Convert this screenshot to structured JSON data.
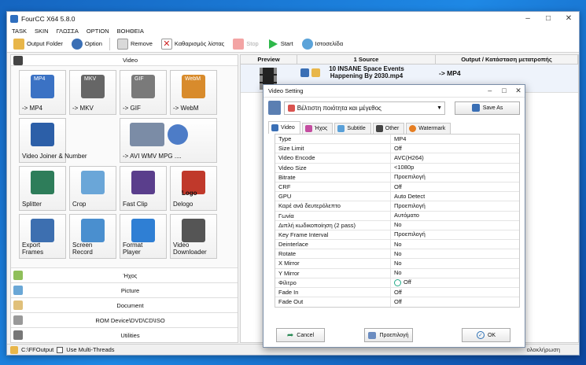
{
  "window": {
    "title": "FourCC X64 5.8.0"
  },
  "menu": [
    "TASK",
    "SKIN",
    "ΓΛΩΣΣΑ",
    "OPTION",
    "ΒΟΗΘΕΙΑ"
  ],
  "toolbar": {
    "output_folder": "Output Folder",
    "option": "Option",
    "remove": "Remove",
    "clear_list": "Καθαρισμός λίστας",
    "stop": "Stop",
    "start": "Start",
    "website": "Ιστοσελίδα"
  },
  "left": {
    "video_header": "Video",
    "tiles": [
      {
        "label": "-> MP4",
        "badge": "MP4"
      },
      {
        "label": "-> MKV",
        "badge": "MKV"
      },
      {
        "label": "-> GIF",
        "badge": "GIF"
      },
      {
        "label": "-> WebM",
        "badge": "WebM"
      },
      {
        "label": "Video Joiner & Number"
      },
      {
        "label": "-> AVI WMV MPG ...."
      },
      {
        "label": "Splitter"
      },
      {
        "label": "Crop"
      },
      {
        "label": "Fast Clip"
      },
      {
        "label": "Delogo",
        "badge": "Logo"
      },
      {
        "label": "Export\nFrames"
      },
      {
        "label": "Screen\nRecord"
      },
      {
        "label": "Format\nPlayer"
      },
      {
        "label": "Video\nDownloader"
      }
    ],
    "categories": [
      "Ήχος",
      "Picture",
      "Document",
      "ROM Device\\DVD\\CD\\ISO",
      "Utilities"
    ]
  },
  "status": {
    "path": "C:\\FFOutput",
    "multithread": "Use Multi-Threads",
    "right_fragment": "ολοκλήρωση"
  },
  "table": {
    "headers": [
      "Preview",
      "1 Source",
      "Output / Κατάσταση μετατροπής"
    ],
    "row": {
      "source_line1": "10 INSANE Space Events",
      "source_line2": "Happening By 2030.mp4",
      "output": "-> MP4"
    }
  },
  "dialog": {
    "title": "Video Setting",
    "preset": "Βέλτιστη ποιότητα και μέγεθος",
    "save_as": "Save As",
    "tabs": [
      "Video",
      "Ήχος",
      "Subtitle",
      "Other",
      "Watermark"
    ],
    "properties": [
      {
        "key": "Type",
        "value": "MP4"
      },
      {
        "key": "Size Limit",
        "value": "Off"
      },
      {
        "key": "Video Encode",
        "value": "AVC(H264)"
      },
      {
        "key": "Video Size",
        "value": "<1080p"
      },
      {
        "key": "Bitrate",
        "value": "Προεπιλογή"
      },
      {
        "key": "CRF",
        "value": "Off"
      },
      {
        "key": "GPU",
        "value": "Auto Detect"
      },
      {
        "key": "Καρέ ανά δευτερόλεπτο",
        "value": "Προεπιλογή"
      },
      {
        "key": "Γωνία",
        "value": "Αυτόματο"
      },
      {
        "key": "Διπλή κωδικοποίηση (2 pass)",
        "value": "No"
      },
      {
        "key": "Key Frame Interval",
        "value": "Προεπιλογή"
      },
      {
        "key": "Deinterlace",
        "value": "No"
      },
      {
        "key": "Rotate",
        "value": "No"
      },
      {
        "key": "X Mirror",
        "value": "No"
      },
      {
        "key": "Y Mirror",
        "value": "No"
      },
      {
        "key": "Φίλτρο",
        "value": "Off"
      },
      {
        "key": "Fade In",
        "value": "Off"
      },
      {
        "key": "Fade Out",
        "value": "Off"
      }
    ],
    "buttons": {
      "cancel": "Cancel",
      "default": "Προεπιλογή",
      "ok": "OK"
    }
  }
}
